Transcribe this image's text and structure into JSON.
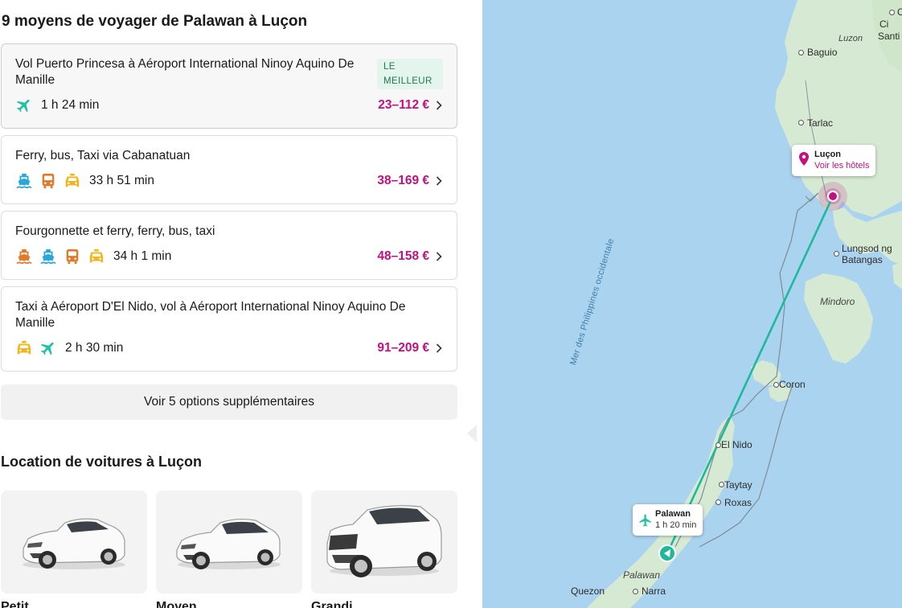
{
  "heading": "9 moyens de voyager de Palawan à Luçon",
  "routes": [
    {
      "title": "Vol Puerto Princesa à Aéroport International Ninoy Aquino De Manille",
      "badge": "LE MEILLEUR",
      "duration": "1 h 24 min",
      "price": "23–112 €",
      "modes": [
        "plane-icon"
      ]
    },
    {
      "title": "Ferry, bus, Taxi via Cabanatuan",
      "duration": "33 h 51 min",
      "price": "38–169 €",
      "modes": [
        "ferry-icon",
        "bus-icon",
        "taxi-icon"
      ]
    },
    {
      "title": "Fourgonnette et ferry, ferry, bus, taxi",
      "duration": "34 h 1 min",
      "price": "48–158 €",
      "modes": [
        "van-icon",
        "ferry-icon",
        "bus-icon",
        "taxi-icon"
      ]
    },
    {
      "title": "Taxi à Aéroport D'El Nido, vol à Aéroport International Ninoy Aquino De Manille",
      "duration": "2 h 30 min",
      "price": "91–209 €",
      "modes": [
        "taxi-icon",
        "plane-icon"
      ]
    }
  ],
  "more_button": "Voir 5 options supplémentaires",
  "car_heading": "Location de voitures à Luçon",
  "cars": [
    {
      "label": "Petit"
    },
    {
      "label": "Moyen"
    },
    {
      "label": "Grandi"
    }
  ],
  "map": {
    "places": {
      "baguio": "Baguio",
      "tarlac": "Tarlac",
      "luzon_region": "Luzon",
      "lungsod": "Lungsod ng",
      "batangas": "Batangas",
      "mindoro": "Mindoro",
      "coron": "Coron",
      "elnido": "El Nido",
      "taytay": "Taytay",
      "roxas": "Roxas",
      "palawan": "Palawan",
      "quezon": "Quezon",
      "narra": "Narra",
      "ci": "Ci",
      "ca": "Ca",
      "santi": "Santi"
    },
    "sea_label": "Mer des Philippines occidentale",
    "dest_popup": {
      "title": "Luçon",
      "link": "Voir les hôtels"
    },
    "origin_popup": {
      "title": "Palawan",
      "sub": "1 h 20 min"
    }
  },
  "colors": {
    "accent": "#c4107f",
    "route": "#1fb89a",
    "plane": "#1ec3a5",
    "ferry": "#2aa7d6",
    "bus": "#e07a2c",
    "taxi": "#f2b51b",
    "sea": "#aad3f0",
    "land": "#d6ead3"
  }
}
